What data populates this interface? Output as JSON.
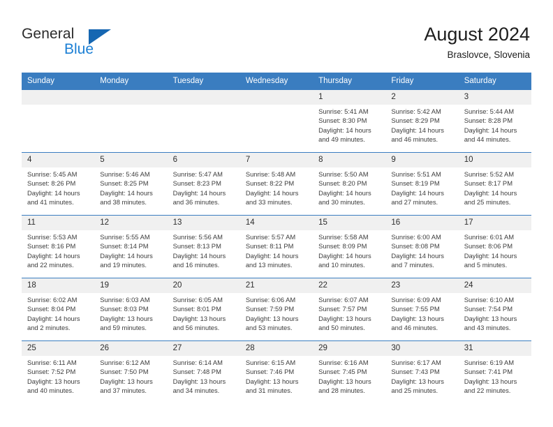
{
  "brand": {
    "word1": "General",
    "word2": "Blue",
    "triangle_color": "#1667b2",
    "word2_color": "#1b7fd4"
  },
  "header": {
    "title": "August 2024",
    "subtitle": "Braslovce, Slovenia"
  },
  "theme": {
    "header_bg": "#3a7dc0",
    "daynum_bg": "#f0f0f0",
    "grid_line": "#3a7dc0",
    "text": "#3c3c3c"
  },
  "calendar": {
    "weekday_headers": [
      "Sunday",
      "Monday",
      "Tuesday",
      "Wednesday",
      "Thursday",
      "Friday",
      "Saturday"
    ],
    "weeks": [
      [
        {
          "day": "",
          "sunrise": "",
          "sunset": "",
          "daylight1": "",
          "daylight2": ""
        },
        {
          "day": "",
          "sunrise": "",
          "sunset": "",
          "daylight1": "",
          "daylight2": ""
        },
        {
          "day": "",
          "sunrise": "",
          "sunset": "",
          "daylight1": "",
          "daylight2": ""
        },
        {
          "day": "",
          "sunrise": "",
          "sunset": "",
          "daylight1": "",
          "daylight2": ""
        },
        {
          "day": "1",
          "sunrise": "Sunrise: 5:41 AM",
          "sunset": "Sunset: 8:30 PM",
          "daylight1": "Daylight: 14 hours",
          "daylight2": "and 49 minutes."
        },
        {
          "day": "2",
          "sunrise": "Sunrise: 5:42 AM",
          "sunset": "Sunset: 8:29 PM",
          "daylight1": "Daylight: 14 hours",
          "daylight2": "and 46 minutes."
        },
        {
          "day": "3",
          "sunrise": "Sunrise: 5:44 AM",
          "sunset": "Sunset: 8:28 PM",
          "daylight1": "Daylight: 14 hours",
          "daylight2": "and 44 minutes."
        }
      ],
      [
        {
          "day": "4",
          "sunrise": "Sunrise: 5:45 AM",
          "sunset": "Sunset: 8:26 PM",
          "daylight1": "Daylight: 14 hours",
          "daylight2": "and 41 minutes."
        },
        {
          "day": "5",
          "sunrise": "Sunrise: 5:46 AM",
          "sunset": "Sunset: 8:25 PM",
          "daylight1": "Daylight: 14 hours",
          "daylight2": "and 38 minutes."
        },
        {
          "day": "6",
          "sunrise": "Sunrise: 5:47 AM",
          "sunset": "Sunset: 8:23 PM",
          "daylight1": "Daylight: 14 hours",
          "daylight2": "and 36 minutes."
        },
        {
          "day": "7",
          "sunrise": "Sunrise: 5:48 AM",
          "sunset": "Sunset: 8:22 PM",
          "daylight1": "Daylight: 14 hours",
          "daylight2": "and 33 minutes."
        },
        {
          "day": "8",
          "sunrise": "Sunrise: 5:50 AM",
          "sunset": "Sunset: 8:20 PM",
          "daylight1": "Daylight: 14 hours",
          "daylight2": "and 30 minutes."
        },
        {
          "day": "9",
          "sunrise": "Sunrise: 5:51 AM",
          "sunset": "Sunset: 8:19 PM",
          "daylight1": "Daylight: 14 hours",
          "daylight2": "and 27 minutes."
        },
        {
          "day": "10",
          "sunrise": "Sunrise: 5:52 AM",
          "sunset": "Sunset: 8:17 PM",
          "daylight1": "Daylight: 14 hours",
          "daylight2": "and 25 minutes."
        }
      ],
      [
        {
          "day": "11",
          "sunrise": "Sunrise: 5:53 AM",
          "sunset": "Sunset: 8:16 PM",
          "daylight1": "Daylight: 14 hours",
          "daylight2": "and 22 minutes."
        },
        {
          "day": "12",
          "sunrise": "Sunrise: 5:55 AM",
          "sunset": "Sunset: 8:14 PM",
          "daylight1": "Daylight: 14 hours",
          "daylight2": "and 19 minutes."
        },
        {
          "day": "13",
          "sunrise": "Sunrise: 5:56 AM",
          "sunset": "Sunset: 8:13 PM",
          "daylight1": "Daylight: 14 hours",
          "daylight2": "and 16 minutes."
        },
        {
          "day": "14",
          "sunrise": "Sunrise: 5:57 AM",
          "sunset": "Sunset: 8:11 PM",
          "daylight1": "Daylight: 14 hours",
          "daylight2": "and 13 minutes."
        },
        {
          "day": "15",
          "sunrise": "Sunrise: 5:58 AM",
          "sunset": "Sunset: 8:09 PM",
          "daylight1": "Daylight: 14 hours",
          "daylight2": "and 10 minutes."
        },
        {
          "day": "16",
          "sunrise": "Sunrise: 6:00 AM",
          "sunset": "Sunset: 8:08 PM",
          "daylight1": "Daylight: 14 hours",
          "daylight2": "and 7 minutes."
        },
        {
          "day": "17",
          "sunrise": "Sunrise: 6:01 AM",
          "sunset": "Sunset: 8:06 PM",
          "daylight1": "Daylight: 14 hours",
          "daylight2": "and 5 minutes."
        }
      ],
      [
        {
          "day": "18",
          "sunrise": "Sunrise: 6:02 AM",
          "sunset": "Sunset: 8:04 PM",
          "daylight1": "Daylight: 14 hours",
          "daylight2": "and 2 minutes."
        },
        {
          "day": "19",
          "sunrise": "Sunrise: 6:03 AM",
          "sunset": "Sunset: 8:03 PM",
          "daylight1": "Daylight: 13 hours",
          "daylight2": "and 59 minutes."
        },
        {
          "day": "20",
          "sunrise": "Sunrise: 6:05 AM",
          "sunset": "Sunset: 8:01 PM",
          "daylight1": "Daylight: 13 hours",
          "daylight2": "and 56 minutes."
        },
        {
          "day": "21",
          "sunrise": "Sunrise: 6:06 AM",
          "sunset": "Sunset: 7:59 PM",
          "daylight1": "Daylight: 13 hours",
          "daylight2": "and 53 minutes."
        },
        {
          "day": "22",
          "sunrise": "Sunrise: 6:07 AM",
          "sunset": "Sunset: 7:57 PM",
          "daylight1": "Daylight: 13 hours",
          "daylight2": "and 50 minutes."
        },
        {
          "day": "23",
          "sunrise": "Sunrise: 6:09 AM",
          "sunset": "Sunset: 7:55 PM",
          "daylight1": "Daylight: 13 hours",
          "daylight2": "and 46 minutes."
        },
        {
          "day": "24",
          "sunrise": "Sunrise: 6:10 AM",
          "sunset": "Sunset: 7:54 PM",
          "daylight1": "Daylight: 13 hours",
          "daylight2": "and 43 minutes."
        }
      ],
      [
        {
          "day": "25",
          "sunrise": "Sunrise: 6:11 AM",
          "sunset": "Sunset: 7:52 PM",
          "daylight1": "Daylight: 13 hours",
          "daylight2": "and 40 minutes."
        },
        {
          "day": "26",
          "sunrise": "Sunrise: 6:12 AM",
          "sunset": "Sunset: 7:50 PM",
          "daylight1": "Daylight: 13 hours",
          "daylight2": "and 37 minutes."
        },
        {
          "day": "27",
          "sunrise": "Sunrise: 6:14 AM",
          "sunset": "Sunset: 7:48 PM",
          "daylight1": "Daylight: 13 hours",
          "daylight2": "and 34 minutes."
        },
        {
          "day": "28",
          "sunrise": "Sunrise: 6:15 AM",
          "sunset": "Sunset: 7:46 PM",
          "daylight1": "Daylight: 13 hours",
          "daylight2": "and 31 minutes."
        },
        {
          "day": "29",
          "sunrise": "Sunrise: 6:16 AM",
          "sunset": "Sunset: 7:45 PM",
          "daylight1": "Daylight: 13 hours",
          "daylight2": "and 28 minutes."
        },
        {
          "day": "30",
          "sunrise": "Sunrise: 6:17 AM",
          "sunset": "Sunset: 7:43 PM",
          "daylight1": "Daylight: 13 hours",
          "daylight2": "and 25 minutes."
        },
        {
          "day": "31",
          "sunrise": "Sunrise: 6:19 AM",
          "sunset": "Sunset: 7:41 PM",
          "daylight1": "Daylight: 13 hours",
          "daylight2": "and 22 minutes."
        }
      ]
    ]
  }
}
